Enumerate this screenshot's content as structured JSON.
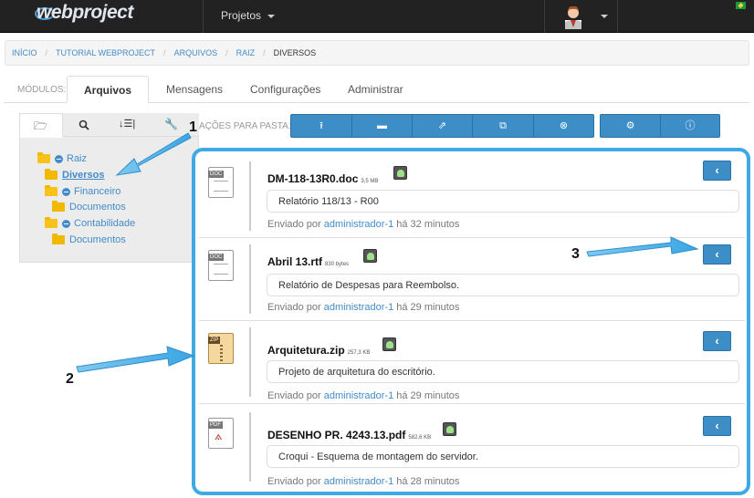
{
  "topbar": {
    "logo": "webproject",
    "menu_projetos": "Projetos"
  },
  "breadcrumb": [
    "INÍCIO",
    "TUTORIAL WEBPROJECT",
    "ARQUIVOS",
    "RAIZ",
    "DIVERSOS"
  ],
  "modules": {
    "label": "MÓDULOS:",
    "tabs": [
      "Arquivos",
      "Mensagens",
      "Configurações",
      "Administrar"
    ],
    "active": "Arquivos"
  },
  "tree": {
    "items": [
      {
        "label": "Raiz",
        "level": 0,
        "open": true
      },
      {
        "label": "Diversos",
        "level": 1,
        "selected": true
      },
      {
        "label": "Financeiro",
        "level": 1,
        "open": true
      },
      {
        "label": "Documentos",
        "level": 2
      },
      {
        "label": "Contabilidade",
        "level": 1,
        "open": true
      },
      {
        "label": "Documentos",
        "level": 2
      }
    ]
  },
  "actions_label": "AÇÕES PARA PASTA:",
  "files": [
    {
      "name": "DM-118-13R0.doc",
      "size": "3,5 MB",
      "type": "DOC",
      "description": "Relatório 118/13 - R00",
      "sent_prefix": "Enviado por",
      "user": "administrador-1",
      "time": "há 32 minutos"
    },
    {
      "name": "Abril 13.rtf",
      "size": "830 bytes",
      "type": "DOC",
      "description": "Relatório de Despesas para Reembolso.",
      "sent_prefix": "Enviado por",
      "user": "administrador-1",
      "time": "há 29 minutos"
    },
    {
      "name": "Arquitetura.zip",
      "size": "257,3 KB",
      "type": "ZIP",
      "description": "Projeto de arquitetura do escritório.",
      "sent_prefix": "Enviado por",
      "user": "administrador-1",
      "time": "há 29 minutos"
    },
    {
      "name": "DESENHO PR. 4243.13.pdf",
      "size": "582,6 KB",
      "type": "PDF",
      "description": "Croqui - Esquema de montagem do servidor.",
      "sent_prefix": "Enviado por",
      "user": "administrador-1",
      "time": "há 28 minutos"
    }
  ],
  "callouts": [
    "1",
    "2",
    "3"
  ],
  "colors": {
    "accent": "#3d8dc7",
    "highlight": "#3fa9e6",
    "link": "#428bca",
    "topbar": "#222222",
    "folder": "#f1b800"
  }
}
